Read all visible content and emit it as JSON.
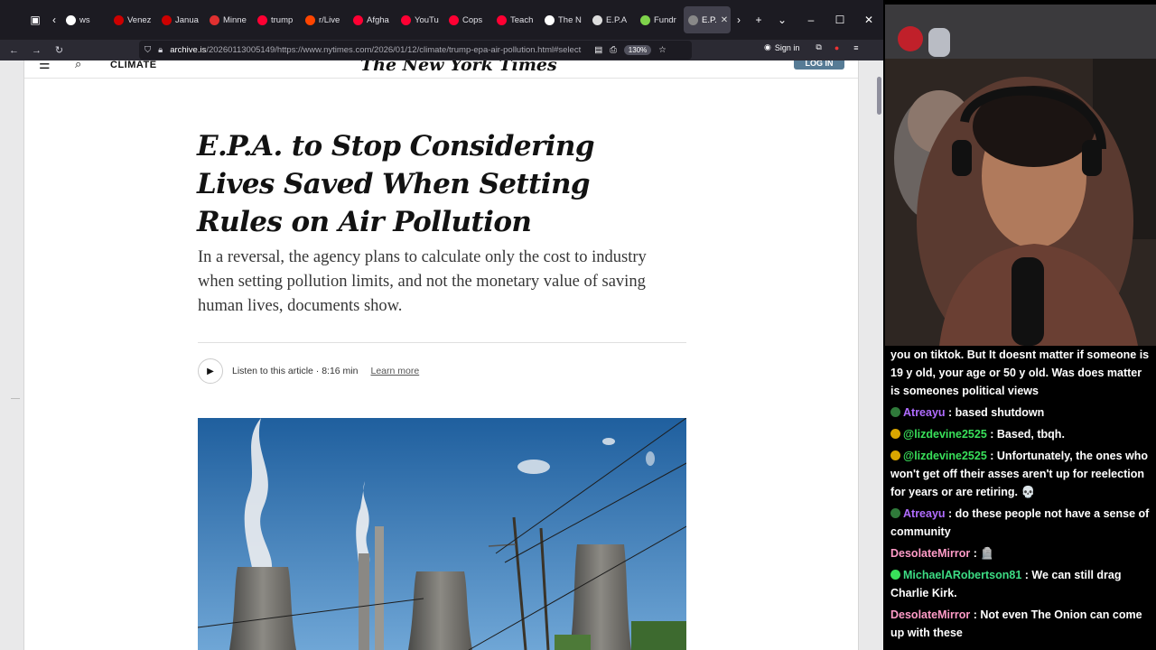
{
  "browser": {
    "tabs": [
      {
        "label": "ws",
        "color": "#ffffff"
      },
      {
        "label": "Venez",
        "color": "#cc0000"
      },
      {
        "label": "Janua",
        "color": "#cc0000"
      },
      {
        "label": "Minne",
        "color": "#e03030"
      },
      {
        "label": "trump",
        "color": "#ff0033"
      },
      {
        "label": "r/Live",
        "color": "#ff4500"
      },
      {
        "label": "Afgha",
        "color": "#ff0033"
      },
      {
        "label": "YouTu",
        "color": "#ff0033"
      },
      {
        "label": "Cops",
        "color": "#ff0033"
      },
      {
        "label": "Teach",
        "color": "#ff0033"
      },
      {
        "label": "The N",
        "color": "#ffffff"
      },
      {
        "label": "E.P.A",
        "color": "#dddddd"
      },
      {
        "label": "Fundr",
        "color": "#7fd34b"
      },
      {
        "label": "E.P.",
        "color": "#888888"
      }
    ],
    "url_host": "archive.is",
    "url_path": "/20260113005149/https://www.nytimes.com/2026/01/12/climate/trump-epa-air-pollution.html#select",
    "zoom": "130%",
    "sign_in": "Sign in"
  },
  "nyt": {
    "section": "CLIMATE",
    "logo": "The New York Times",
    "account_btn": "LOG IN",
    "headline": "E.P.A. to Stop Considering Lives Saved When Setting Rules on Air Pollution",
    "summary": "In a reversal, the agency plans to calculate only the cost to industry when setting pollution limits, and not the monetary value of saving human lives, documents show.",
    "listen_text": "Listen to this article · 8:16 min",
    "learn_more": "Learn more"
  },
  "chat": {
    "messages": [
      {
        "user": "",
        "text": "you on tiktok. But It doesnt matter if someone is 19 y old, your age or 50 y old. Was does matter is someones political views",
        "user_class": "",
        "badge": ""
      },
      {
        "user": "Atreayu",
        "text": " : based shutdown",
        "user_class": "user-purple",
        "badge": "#2f7a3a"
      },
      {
        "user": "@lizdevine2525",
        "text": " : Based, tbqh.",
        "user_class": "user-green",
        "badge": "#d9a600"
      },
      {
        "user": "@lizdevine2525",
        "text": " : Unfortunately, the ones who won't get off their asses aren't up for reelection for years or are retiring. 💀",
        "user_class": "user-green",
        "badge": "#d9a600"
      },
      {
        "user": "Atreayu",
        "text": " : do these people not have a sense of community",
        "user_class": "user-purple",
        "badge": "#2f7a3a"
      },
      {
        "user": "DesolateMirror",
        "text": " : 🪦",
        "user_class": "user-pink",
        "badge": ""
      },
      {
        "user": "MichaelARobertson81",
        "text": " : We can still drag Charlie Kirk.",
        "user_class": "user-teal",
        "badge": "#39e05a"
      },
      {
        "user": "DesolateMirror",
        "text": " : Not even The Onion can come up with these",
        "user_class": "user-pink",
        "badge": ""
      }
    ]
  }
}
